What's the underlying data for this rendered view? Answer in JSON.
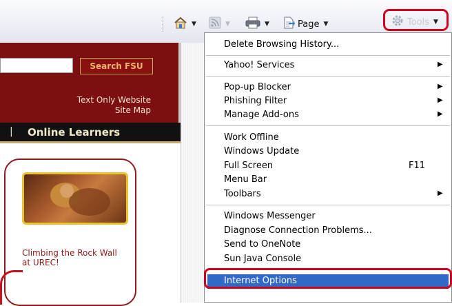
{
  "toolbar": {
    "home_icon": "home-icon",
    "feeds_icon": "feeds-icon",
    "print_icon": "print-icon",
    "page_label": "Page",
    "tools_label": "Tools"
  },
  "site": {
    "search_button": "Search FSU",
    "text_only": "Text Only Website",
    "site_map": "Site Map",
    "nav_separator": "|",
    "nav_item": "Online Learners",
    "card_caption": "Climbing the Rock Wall at UREC!"
  },
  "menu": {
    "items": [
      {
        "label": "Delete Browsing History...",
        "shortcut": "",
        "submenu": false
      },
      {
        "label": "Yahoo! Services",
        "shortcut": "",
        "submenu": true
      },
      {
        "label": "Pop-up Blocker",
        "shortcut": "",
        "submenu": true
      },
      {
        "label": "Phishing Filter",
        "shortcut": "",
        "submenu": true
      },
      {
        "label": "Manage Add-ons",
        "shortcut": "",
        "submenu": true
      },
      {
        "label": "Work Offline",
        "shortcut": "",
        "submenu": false
      },
      {
        "label": "Windows Update",
        "shortcut": "",
        "submenu": false
      },
      {
        "label": "Full Screen",
        "shortcut": "F11",
        "submenu": false
      },
      {
        "label": "Menu Bar",
        "shortcut": "",
        "submenu": false
      },
      {
        "label": "Toolbars",
        "shortcut": "",
        "submenu": true
      },
      {
        "label": "Windows Messenger",
        "shortcut": "",
        "submenu": false
      },
      {
        "label": "Diagnose Connection Problems...",
        "shortcut": "",
        "submenu": false
      },
      {
        "label": "Send to OneNote",
        "shortcut": "",
        "submenu": false
      },
      {
        "label": "Sun Java Console",
        "shortcut": "",
        "submenu": false
      },
      {
        "label": "Internet Options",
        "shortcut": "",
        "submenu": false,
        "selected": true
      }
    ],
    "submenu_arrow": "▶"
  },
  "colors": {
    "highlight_red": "#d3001d",
    "selection_blue": "#3169c6",
    "fsu_garnet": "#7c0f10"
  }
}
